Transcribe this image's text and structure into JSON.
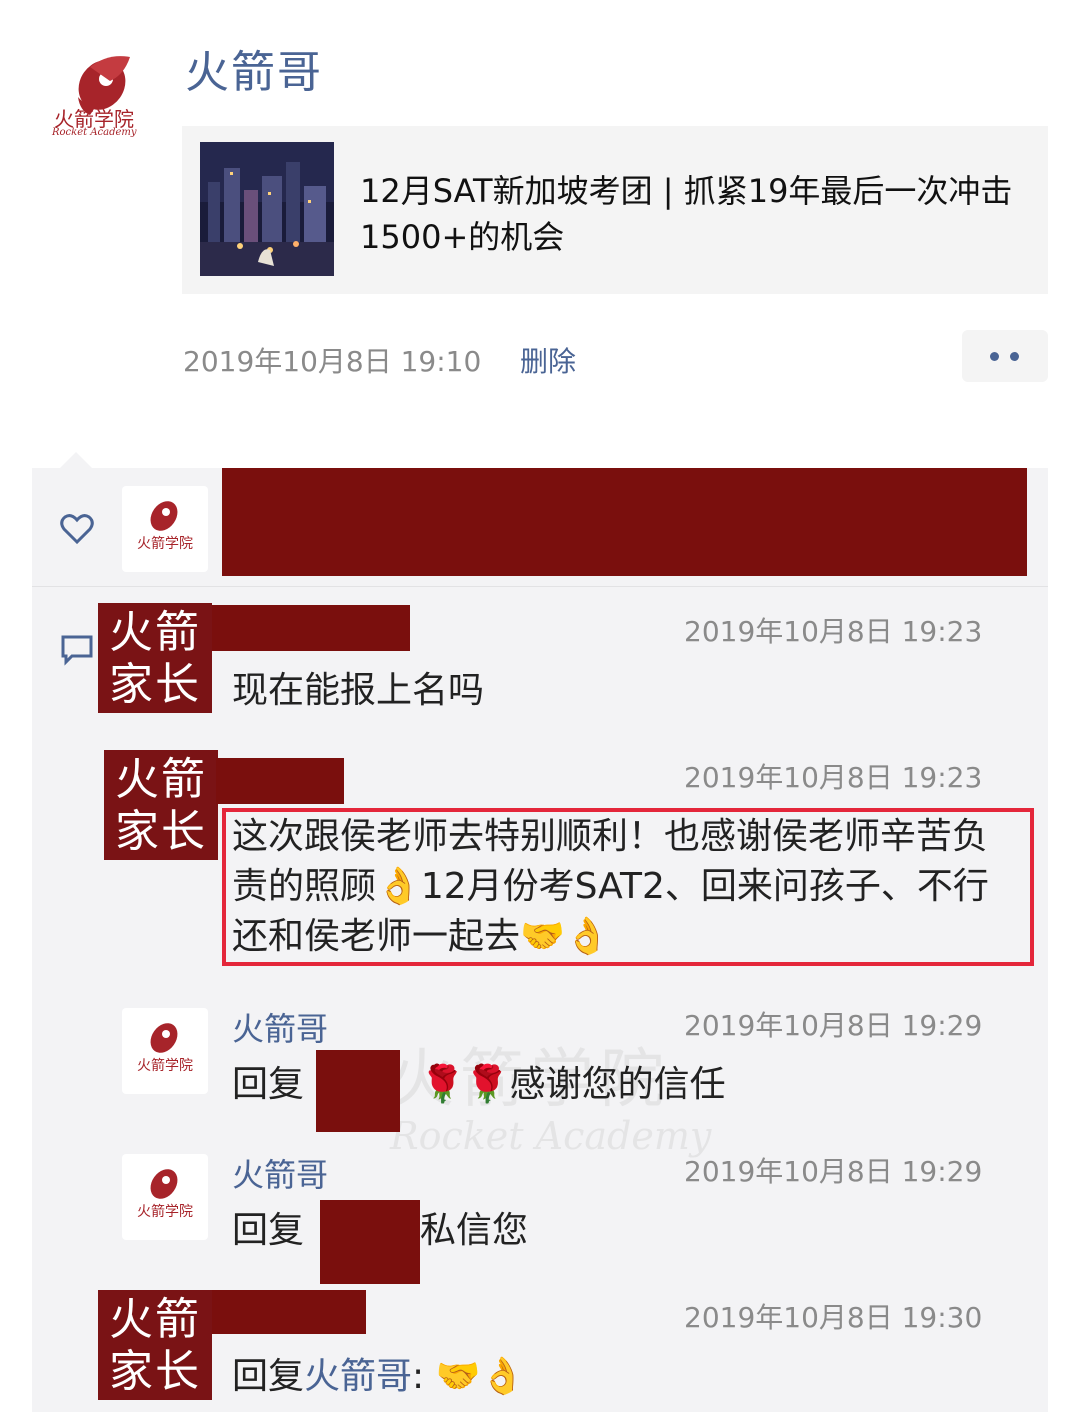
{
  "post": {
    "author": "火箭哥",
    "logo_cn": "火箭学院",
    "logo_en": "Rocket Academy",
    "link_title": "12月SAT新加坡考团 | 抓紧19年最后一次冲击1500+的机会",
    "timestamp": "2019年10月8日 19:10",
    "delete_label": "删除"
  },
  "likes": {
    "icon": "heart-icon"
  },
  "comments": [
    {
      "avatar_text_1": "火箭",
      "avatar_text_2": "家长",
      "time": "2019年10月8日 19:23",
      "text": "现在能报上名吗"
    },
    {
      "avatar_text_1": "火箭",
      "avatar_text_2": "家长",
      "time": "2019年10月8日 19:23",
      "text": "这次跟侯老师去特别顺利！也感谢侯老师辛苦负责的照顾👌12月份考SAT2、回来问孩子、不行还和侯老师一起去🤝👌"
    },
    {
      "name": "火箭哥",
      "time": "2019年10月8日 19:29",
      "text_prefix": "回复",
      "text_suffix": "🌹🌹感谢您的信任"
    },
    {
      "name": "火箭哥",
      "time": "2019年10月8日 19:29",
      "text_prefix": "回复",
      "text_suffix": "私信您"
    },
    {
      "avatar_text_1": "火箭",
      "avatar_text_2": "家长",
      "time": "2019年10月8日 19:30",
      "text_prefix": "回复",
      "reply_to": "火箭哥",
      "text_suffix": ": 🤝👌"
    }
  ],
  "watermark": {
    "cn": "火箭学院",
    "en": "Rocket Academy"
  },
  "colors": {
    "link_blue": "#4a6494",
    "redaction": "#7a0f0d",
    "highlight": "#e4263a",
    "panel_bg": "#f3f3f5"
  }
}
